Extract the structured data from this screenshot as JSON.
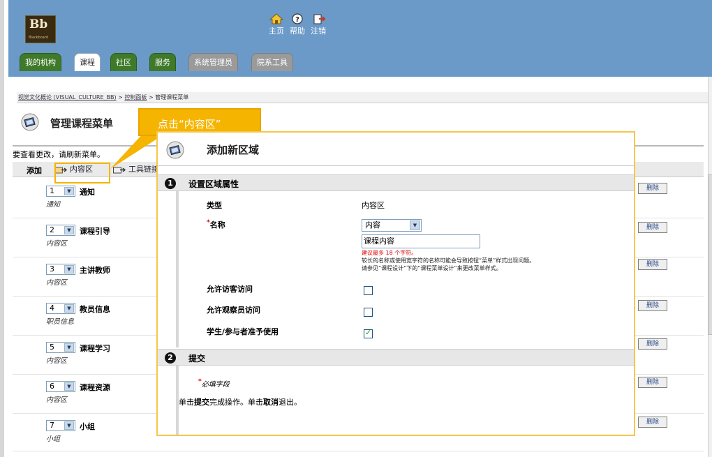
{
  "header": {
    "logo_text": "Bb",
    "logo_subtext": "Blackboard",
    "top_links": [
      {
        "icon": "home-icon",
        "label": "主页"
      },
      {
        "icon": "help-icon",
        "label": "帮助"
      },
      {
        "icon": "logout-icon",
        "label": "注销"
      }
    ]
  },
  "tabs": [
    {
      "label": "我的机构",
      "state": "normal"
    },
    {
      "label": "课程",
      "state": "active"
    },
    {
      "label": "社区",
      "state": "normal"
    },
    {
      "label": "服务",
      "state": "normal"
    },
    {
      "label": "系统管理员",
      "state": "gray"
    },
    {
      "label": "院系工具",
      "state": "gray"
    }
  ],
  "breadcrumb": {
    "items": [
      "视觉文化概论 (VISUAL_CULTURE_BB)",
      "控制面板",
      "管理课程菜单"
    ],
    "separator": ">"
  },
  "page": {
    "title": "管理课程菜单",
    "refresh_note": "要查看更改，请刷新菜单。",
    "toolbar": {
      "add_label": "添加",
      "content_area_label": "内容区",
      "tools_label": "工具链接"
    }
  },
  "menu_items": [
    {
      "order": "1",
      "name": "通知",
      "type": "通知"
    },
    {
      "order": "2",
      "name": "课程引导",
      "type": "内容区"
    },
    {
      "order": "3",
      "name": "主讲教师",
      "type": "内容区"
    },
    {
      "order": "4",
      "name": "教员信息",
      "type": "职员信息"
    },
    {
      "order": "5",
      "name": "课程学习",
      "type": "内容区"
    },
    {
      "order": "6",
      "name": "课程资源",
      "type": "内容区"
    },
    {
      "order": "7",
      "name": "小组",
      "type": "小组"
    }
  ],
  "delete_label": "删除",
  "callout": {
    "text": "点击“内容区”",
    "color": "#f4b400"
  },
  "dialog": {
    "title": "添加新区域",
    "section1": {
      "number": "1",
      "title": "设置区域属性",
      "type_label": "类型",
      "type_value": "内容区",
      "name_label": "名称",
      "name_select_value": "内容",
      "name_input_value": "课程内容",
      "name_hint": "建议最多 18 个字符。",
      "name_note_line1": "较长的名称或使用宽字符的名称可能会导致按钮“菜单”样式出现问题。",
      "name_note_line2": "请参见“课程设计”下的“课程菜单设计”来更改菜单样式。",
      "guest_label": "允许访客访问",
      "guest_checked": false,
      "observer_label": "允许观察员访问",
      "observer_checked": false,
      "student_label": "学生/参与者准予使用",
      "student_checked": true
    },
    "section2": {
      "number": "2",
      "title": "提交",
      "required_note": "必填字段",
      "instruction_prefix": "单击",
      "instruction_submit": "提交",
      "instruction_middle": "完成操作。单击",
      "instruction_cancel": "取消",
      "instruction_suffix": "退出。"
    }
  }
}
